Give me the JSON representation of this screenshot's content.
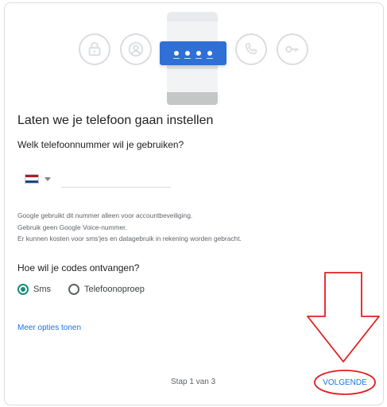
{
  "illustration": {
    "icons": [
      "lock-icon",
      "account-circle-icon",
      "phone-icon",
      "key-icon"
    ],
    "pin_mask": "••••"
  },
  "setup": {
    "title": "Laten we je telefoon gaan instellen",
    "question": "Welk telefoonnummer wil je gebruiken?",
    "country": "Netherlands flag",
    "phone_value": "",
    "info_lines": [
      "Google gebruikt dit nummer alleen voor accountbeveiliging.",
      "Gebruik geen Google Voice-nummer.",
      "Er kunnen kosten voor sms'jes en datagebruik in rekening worden gebracht."
    ],
    "codes_question": "Hoe wil je codes ontvangen?",
    "options": [
      {
        "label": "Sms",
        "checked": true
      },
      {
        "label": "Telefoonoproep",
        "checked": false
      }
    ],
    "more_options": "Meer opties tonen",
    "step": "Stap 1 van 3",
    "next": "VOLGENDE"
  },
  "colors": {
    "accent": "#1a73e8",
    "radio_checked": "#1a8a7a",
    "annotation": "#e01e1e",
    "pin_box": "#2f6fd6"
  },
  "annotation": {
    "arrow": "arrow-down-annotation",
    "ellipse": "highlight-ellipse"
  }
}
